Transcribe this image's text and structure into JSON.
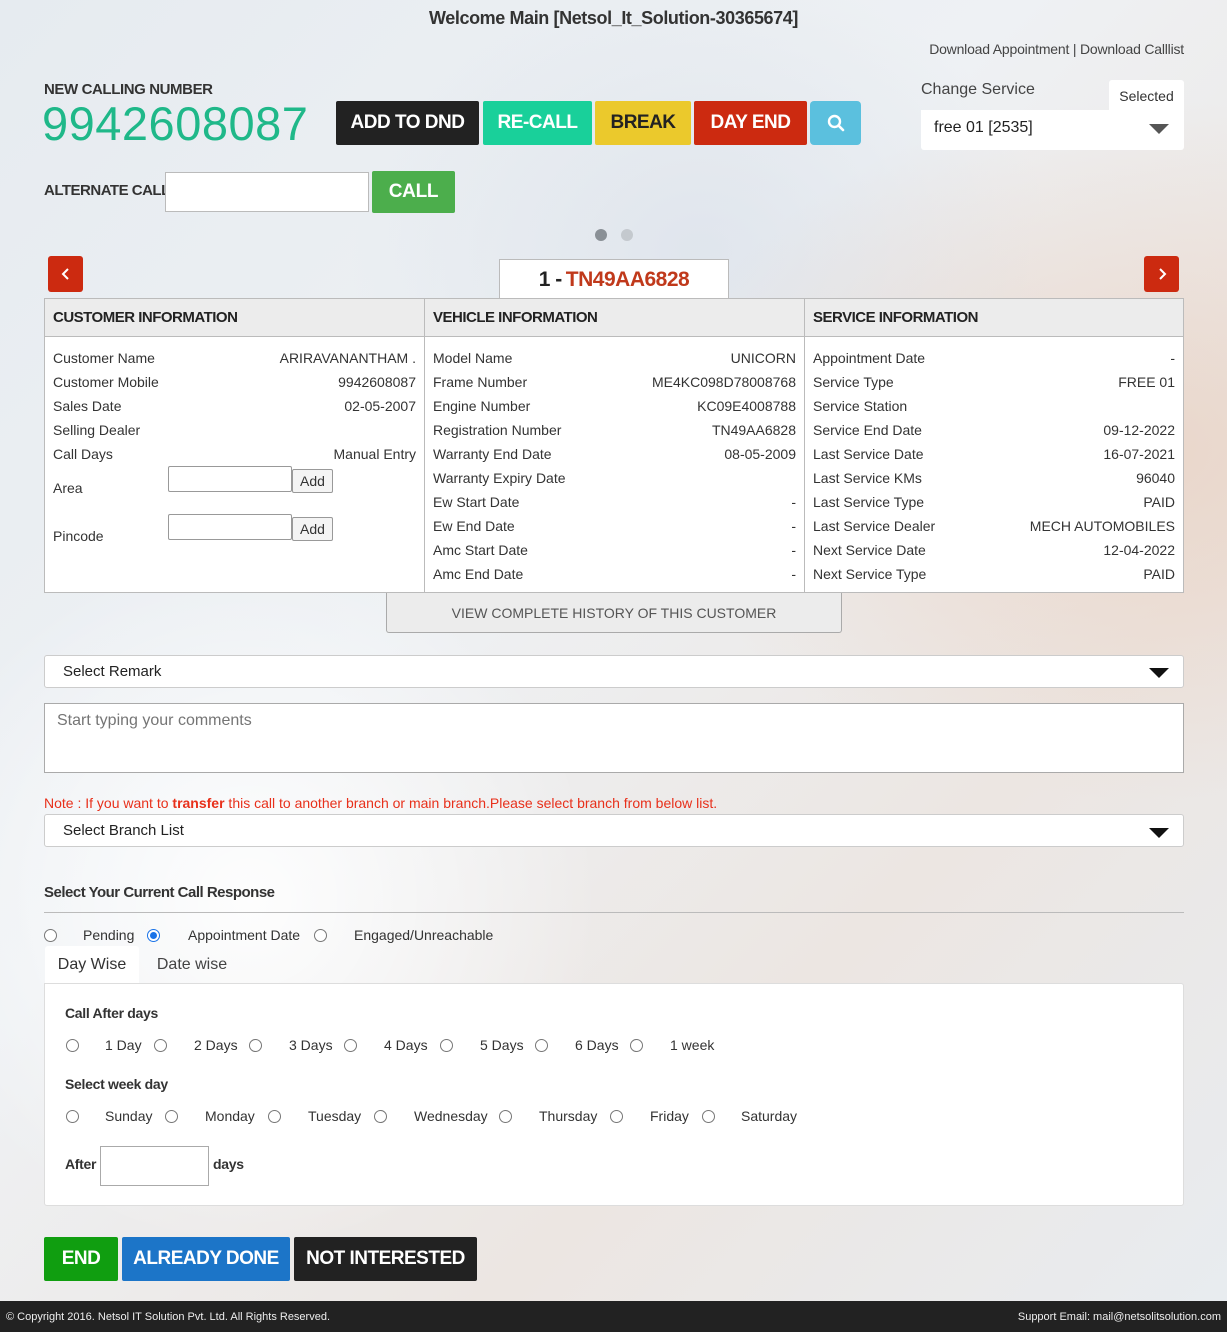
{
  "header": {
    "welcome": "Welcome Main [Netsol_It_Solution-30365674]",
    "download_appointment": "Download Appointment",
    "separator": " | ",
    "download_calllist": "Download Calllist"
  },
  "calling": {
    "label": "NEW CALLING NUMBER",
    "number": "9942608087"
  },
  "actions": {
    "add_to_dnd": "ADD TO DND",
    "recall": "RE-CALL",
    "break": "BREAK",
    "day_end": "DAY END"
  },
  "change_service": {
    "label": "Change Service",
    "selected_tab": "Selected",
    "value": "free 01 [2535]"
  },
  "alternate_call": {
    "label": "ALTERNATE CALL :",
    "value": "",
    "call_label": "CALL"
  },
  "record": {
    "index": "1 -",
    "registration": "TN49AA6828"
  },
  "customer": {
    "heading": "CUSTOMER INFORMATION",
    "rows": [
      {
        "k": "Customer Name",
        "v": "ARIRAVANANTHAM ."
      },
      {
        "k": "Customer Mobile",
        "v": "9942608087"
      },
      {
        "k": "Sales Date",
        "v": "02-05-2007"
      },
      {
        "k": "Selling Dealer",
        "v": ""
      },
      {
        "k": "Call Days",
        "v": "Manual Entry"
      }
    ],
    "area_label": "Area",
    "pincode_label": "Pincode",
    "add_label": "Add"
  },
  "vehicle": {
    "heading": "VEHICLE INFORMATION",
    "rows": [
      {
        "k": "Model Name",
        "v": "UNICORN"
      },
      {
        "k": "Frame Number",
        "v": "ME4KC098D78008768"
      },
      {
        "k": "Engine Number",
        "v": "KC09E4008788"
      },
      {
        "k": "Registration Number",
        "v": "TN49AA6828"
      },
      {
        "k": "Warranty End Date",
        "v": "08-05-2009"
      },
      {
        "k": "Warranty Expiry Date",
        "v": ""
      },
      {
        "k": "Ew Start Date",
        "v": "-"
      },
      {
        "k": "Ew End Date",
        "v": "-"
      },
      {
        "k": "Amc Start Date",
        "v": "-"
      },
      {
        "k": "Amc End Date",
        "v": "-"
      }
    ]
  },
  "service": {
    "heading": "SERVICE INFORMATION",
    "rows": [
      {
        "k": "Appointment Date",
        "v": "-"
      },
      {
        "k": "Service Type",
        "v": "FREE 01"
      },
      {
        "k": "Service Station",
        "v": ""
      },
      {
        "k": "Service End Date",
        "v": "09-12-2022"
      },
      {
        "k": "Last Service Date",
        "v": "16-07-2021"
      },
      {
        "k": "Last Service KMs",
        "v": "96040"
      },
      {
        "k": "Last Service Type",
        "v": "PAID"
      },
      {
        "k": "Last Service Dealer",
        "v": "MECH AUTOMOBILES"
      },
      {
        "k": "Next Service Date",
        "v": "12-04-2022"
      },
      {
        "k": "Next Service Type",
        "v": "PAID"
      }
    ]
  },
  "history_label": "VIEW COMPLETE HISTORY OF THIS CUSTOMER",
  "remark": {
    "value": "Select Remark",
    "comments_placeholder": "Start typing your comments"
  },
  "note": {
    "prefix": "Note : If you want to ",
    "emphasis": "transfer",
    "suffix": " this call to another branch or main branch.Please select branch from below list."
  },
  "branch": {
    "value": "Select Branch List"
  },
  "response": {
    "title": "Select Your Current Call Response",
    "options": [
      "Pending",
      "Appointment Date",
      "Engaged/Unreachable"
    ],
    "selected": "Appointment Date",
    "tabs": [
      "Day Wise",
      "Date wise"
    ],
    "active_tab": "Day Wise",
    "call_after_label": "Call After days",
    "days": [
      "1 Day",
      "2 Days",
      "3 Days",
      "4 Days",
      "5 Days",
      "6 Days",
      "1 week"
    ],
    "week_label": "Select week day",
    "weekdays": [
      "Sunday",
      "Monday",
      "Tuesday",
      "Wednesday",
      "Thursday",
      "Friday",
      "Saturday"
    ],
    "after_label": "After",
    "days_suffix": "days",
    "after_value": ""
  },
  "bottom": {
    "end": "END",
    "already_done": "ALREADY DONE",
    "not_interested": "NOT INTERESTED"
  },
  "footer": {
    "copyright": "© Copyright 2016. Netsol IT Solution Pvt. Ltd. All Rights Reserved.",
    "support": "Support Email: mail@netsolitsolution.com"
  },
  "colors": {
    "number_green": "#1fb889",
    "danger_red": "#cc2a10",
    "info_blue": "#5bc0de"
  }
}
